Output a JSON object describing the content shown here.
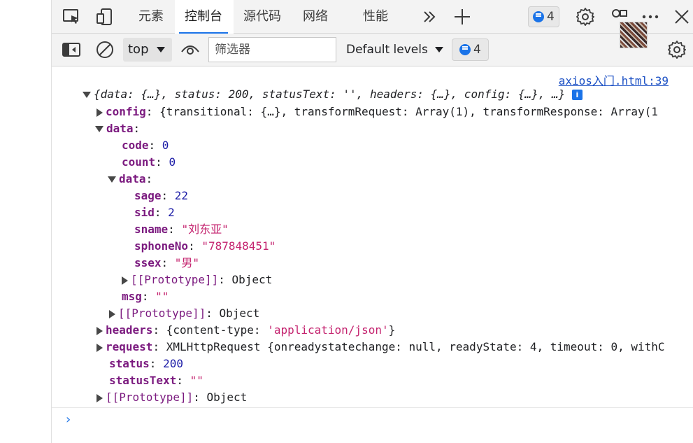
{
  "tabs": [
    {
      "label": "元素"
    },
    {
      "label": "控制台"
    },
    {
      "label": "源代码"
    },
    {
      "label": "网络"
    },
    {
      "label": "性能"
    }
  ],
  "badges": {
    "issues_count": "4",
    "toolbar_count": "4"
  },
  "toolbar": {
    "context": "top",
    "filter_placeholder": "筛选器",
    "levels": "Default levels"
  },
  "colors": {
    "accent": "#1a73e8",
    "key": "#7b1a7f",
    "number": "#1a1aa6",
    "string": "#c4226e"
  },
  "console": {
    "source_link": "axios入门.html:39",
    "summary": "{data: {…}, status: 200, statusText: '', headers: {…}, config: {…}, …}",
    "config_key": "config",
    "config_value": "{transitional: {…}, transformRequest: Array(1), transformResponse: Array(1",
    "data_key": "data",
    "code_key": "code",
    "code_value": "0",
    "count_key": "count",
    "count_value": "0",
    "inner_data_key": "data",
    "sage_key": "sage",
    "sage_value": "22",
    "sid_key": "sid",
    "sid_value": "2",
    "sname_key": "sname",
    "sname_value": "\"刘东亚\"",
    "sphone_key": "sphoneNo",
    "sphone_value": "\"787848451\"",
    "ssex_key": "ssex",
    "ssex_value": "\"男\"",
    "proto_key": "[[Prototype]]",
    "proto_value": "Object",
    "msg_key": "msg",
    "msg_value": "\"\"",
    "headers_key": "headers",
    "headers_value_open": "{content-type: ",
    "headers_value_str": "'application/json'",
    "headers_value_close": "}",
    "request_key": "request",
    "request_value": "XMLHttpRequest {onreadystatechange: null, readyState: 4, timeout: 0, withC",
    "status_key": "status",
    "status_value": "200",
    "statustext_key": "statusText",
    "statustext_value": "\"\"",
    "prompt": "›"
  }
}
